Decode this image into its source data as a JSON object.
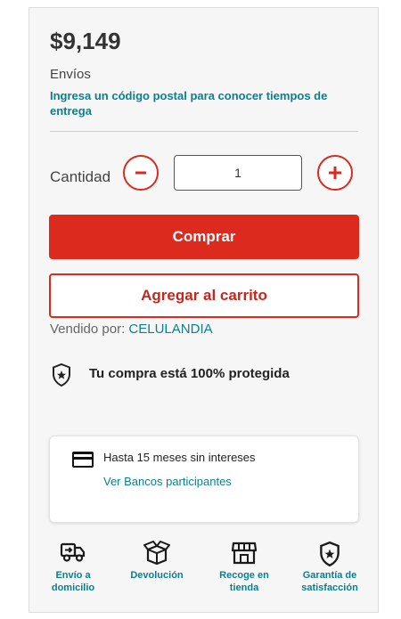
{
  "product": {
    "price": "$9,149",
    "shipping_label": "Envíos",
    "postal_code_link": "Ingresa un código postal para conocer tiempos de entrega"
  },
  "quantity": {
    "label": "Cantidad",
    "decrement_symbol": "-",
    "increment_symbol": "+",
    "value": "1"
  },
  "actions": {
    "buy_label": "Comprar",
    "add_to_cart_label": "Agregar al carrito"
  },
  "seller": {
    "prefix": "Vendido por:",
    "name": "CELULANDIA"
  },
  "protection": {
    "text": "Tu compra está 100% protegida",
    "icon": "shield-star-icon"
  },
  "payment": {
    "title": "Hasta 15 meses sin intereses",
    "link": "Ver Bancos participantes",
    "icon": "credit-card-icon"
  },
  "features": [
    {
      "icon": "truck-icon",
      "label": "Envío a domicilio"
    },
    {
      "icon": "box-return-icon",
      "label": "Devolución"
    },
    {
      "icon": "store-icon",
      "label": "Recoge en tienda"
    },
    {
      "icon": "shield-star-icon",
      "label": "Garantía de satisfacción"
    }
  ],
  "colors": {
    "brand_red": "#dc2a1e",
    "link_teal": "#0b7f8c",
    "panel_bg": "#f6f6f6"
  }
}
